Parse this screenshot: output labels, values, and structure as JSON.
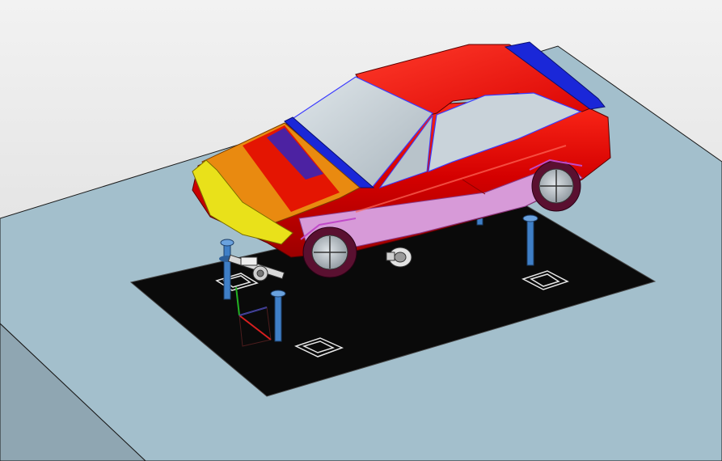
{
  "viewport": {
    "background_top": "#f2f2f2",
    "background_bottom": "#d6d6d6"
  },
  "scene": {
    "floor_color": "#a3bfcc",
    "floor_side_color": "#8fa6b2",
    "mat_color": "#0a0a0a",
    "car": {
      "body_color": "#e30000",
      "body_highlight": "#ff4a3a",
      "body_shadow": "#a80000",
      "glass_color": "#c9d3da",
      "trim_blue": "#1a27d8",
      "hood_orange": "#e98a10",
      "bumper_yellow": "#e9e11a",
      "sill_pink": "#d79ad8",
      "tire_color": "#5a1030",
      "wheel_color": "#b9c0c6",
      "edge_color": "#3b3bff"
    },
    "supports": {
      "color": "#3f7fc7"
    },
    "triad": {
      "x_color": "#d91f1f",
      "y_color": "#23b323",
      "z_color": "#2a4fd6"
    }
  }
}
